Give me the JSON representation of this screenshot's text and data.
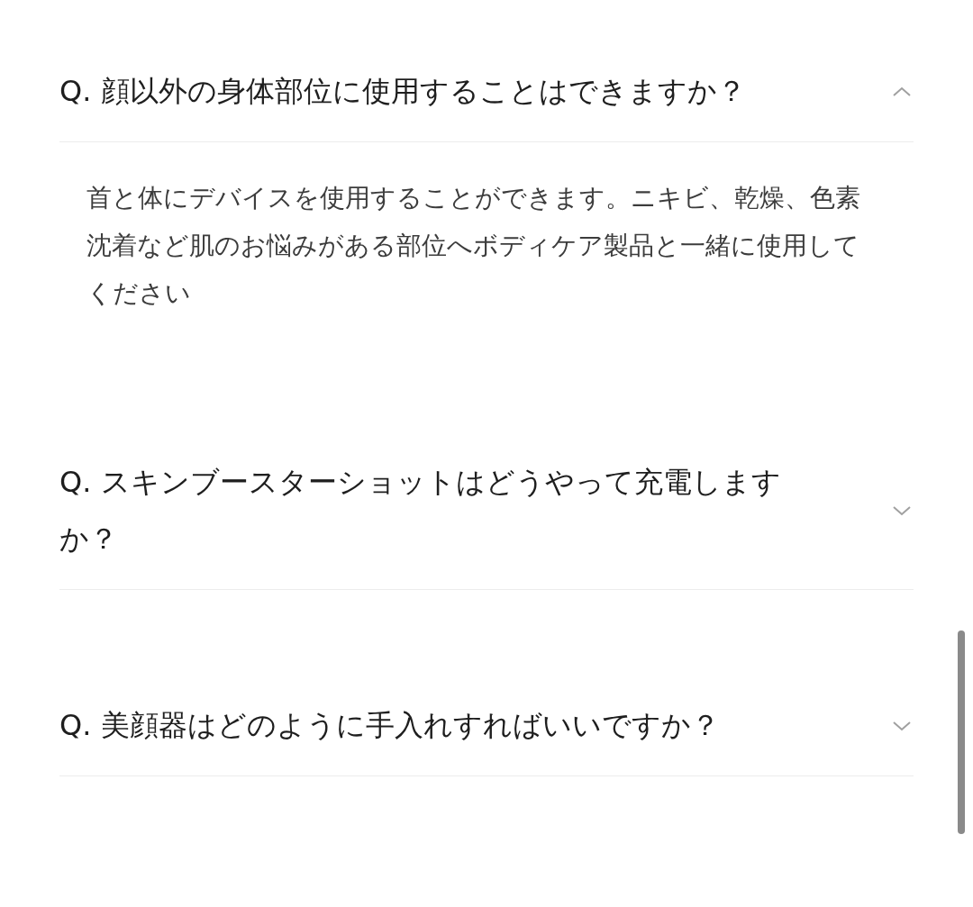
{
  "faq": [
    {
      "question": "Q. 顔以外の身体部位に使用することはできますか？",
      "expanded": true,
      "answer": "首と体にデバイスを使用することができます。ニキビ、乾燥、色素沈着など肌のお悩みがある部位へボディケア製品と一緒に使用してください"
    },
    {
      "question": "Q. スキンブースターショットはどうやって充電しますか？",
      "expanded": false
    },
    {
      "question": "Q. 美顔器はどのように手入れすればいいですか？",
      "expanded": false
    }
  ]
}
